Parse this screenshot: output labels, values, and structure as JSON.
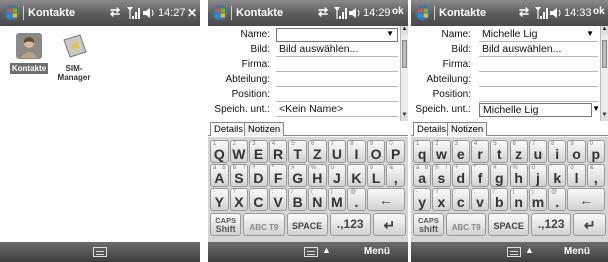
{
  "panel1": {
    "titlebar": {
      "title": "Kontakte",
      "time": "14:27",
      "action": "✕"
    },
    "desktop_icons": [
      {
        "label": "Kontakte",
        "selected": true
      },
      {
        "label": "SIM-\nManager",
        "selected": false
      }
    ]
  },
  "panel2": {
    "titlebar": {
      "title": "Kontakte",
      "time": "14:29",
      "action": "ok"
    },
    "fields": [
      {
        "label": "Name:",
        "value": ""
      },
      {
        "label": "Bild:",
        "value": "Bild auswählen..."
      },
      {
        "label": "Firma:",
        "value": ""
      },
      {
        "label": "Abteilung:",
        "value": ""
      },
      {
        "label": "Position:",
        "value": ""
      },
      {
        "label": "Speich. unt.:",
        "value": "<Kein Name>"
      }
    ],
    "tabs": [
      "Details",
      "Notizen"
    ],
    "menu": "Menü",
    "keyboard_case": "upper"
  },
  "panel3": {
    "titlebar": {
      "title": "Kontakte",
      "time": "14:33",
      "action": "ok"
    },
    "fields": [
      {
        "label": "Name:",
        "value": "Michelle Lig"
      },
      {
        "label": "Bild:",
        "value": "Bild auswählen..."
      },
      {
        "label": "Firma:",
        "value": ""
      },
      {
        "label": "Abteilung:",
        "value": ""
      },
      {
        "label": "Position:",
        "value": ""
      },
      {
        "label": "Speich. unt.:",
        "value": "Michelle Lig"
      }
    ],
    "tabs": [
      "Details",
      "Notizen"
    ],
    "menu": "Menü",
    "keyboard_case": "lower"
  },
  "keyboard": {
    "row1": [
      {
        "top": "1",
        "key": "Q"
      },
      {
        "top": "2",
        "key": "W"
      },
      {
        "top": "3",
        "key": "E"
      },
      {
        "top": "4",
        "key": "R"
      },
      {
        "top": "5",
        "key": "T"
      },
      {
        "top": "6",
        "key": "Z"
      },
      {
        "top": "7",
        "key": "U"
      },
      {
        "top": "8",
        "key": "I"
      },
      {
        "top": "9",
        "key": "O"
      },
      {
        "top": "0",
        "key": "P"
      }
    ],
    "row2": [
      {
        "top": "ä",
        "top2": "8",
        "key": "A"
      },
      {
        "top": "ß",
        "top2": "!",
        "key": "S"
      },
      {
        "top": "+",
        "top2": "",
        "key": "D"
      },
      {
        "top": "*",
        "top2": "",
        "key": "F"
      },
      {
        "top": "#",
        "top2": "",
        "key": "G"
      },
      {
        "top": "%",
        "top2": "",
        "key": "H"
      },
      {
        "top": "ü",
        "top2": "",
        "key": "J"
      },
      {
        "top": "'",
        "top2": "",
        "key": "K"
      },
      {
        "top": "ö",
        "top2": "",
        "key": "L"
      },
      {
        "top": "&",
        "top2": "",
        "key": ","
      }
    ],
    "row3": [
      {
        "top": "-",
        "key": "Y"
      },
      {
        "top": "?",
        "key": "X"
      },
      {
        "top": ":",
        "key": "C"
      },
      {
        "top": ";",
        "key": "V"
      },
      {
        "top": "/",
        "key": "B"
      },
      {
        "top": "(",
        "key": "N"
      },
      {
        "top": ")",
        "key": "M"
      },
      {
        "top": "@",
        "key": "."
      }
    ],
    "caps": "CAPS",
    "shift_upper": "Shift",
    "shift_lower": "shift",
    "abc_t9": "ABC T9",
    "space": "SPACE",
    "num": ".,123",
    "backspace": "←",
    "enter": "↵"
  }
}
